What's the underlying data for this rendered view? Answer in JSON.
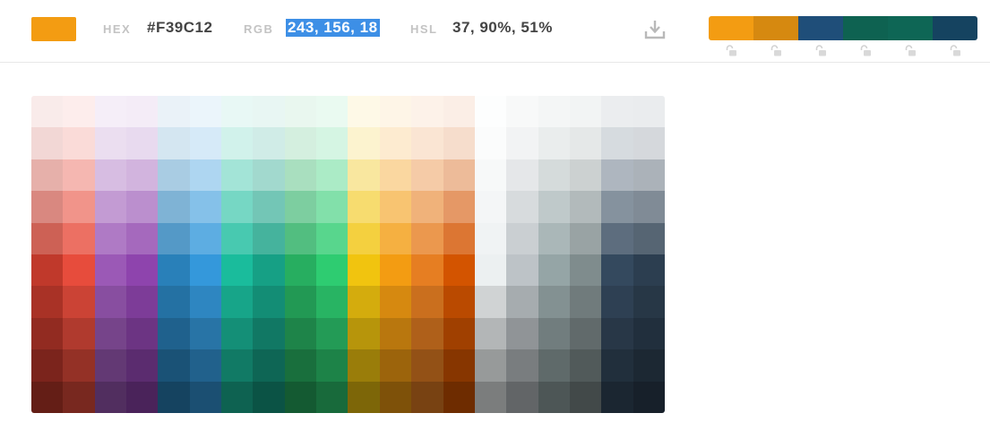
{
  "current": {
    "swatch_color": "#F39C12",
    "hex_label": "HEX",
    "hex_value": "#F39C12",
    "rgb_label": "RGB",
    "rgb_value": "243, 156, 18",
    "hsl_label": "HSL",
    "hsl_value": "37, 90%, 51%"
  },
  "toolbar": {
    "download_icon": "download-icon"
  },
  "palette": {
    "colors": [
      "#F39C12",
      "#D68910",
      "#1F4E79",
      "#0E6251",
      "#0E6655",
      "#154360"
    ],
    "lock_icon": "unlock-icon"
  },
  "grid": {
    "colors": [
      [
        "#F9EBEA",
        "#FDEDEC",
        "#F5EEF8",
        "#F4ECF7",
        "#EAF2F8",
        "#EBF5FB",
        "#E8F8F5",
        "#E8F6F3",
        "#E9F7EF",
        "#EAFAF1",
        "#FEF9E7",
        "#FEF5E7",
        "#FDF2E9",
        "#FBEEE6",
        "#FDFEFE",
        "#F8F9F9",
        "#F4F6F6",
        "#F2F4F4",
        "#EBEDEF",
        "#EAECEE"
      ],
      [
        "#F2D7D5",
        "#FADBD8",
        "#EBDEF0",
        "#E8DAEF",
        "#D4E6F1",
        "#D6EAF8",
        "#D1F2EB",
        "#D0ECE7",
        "#D4EFDF",
        "#D5F5E3",
        "#FCF3CF",
        "#FDEBD0",
        "#FAE5D3",
        "#F6DDCC",
        "#FBFCFC",
        "#F2F3F4",
        "#EAEDED",
        "#E5E8E8",
        "#D6DBDF",
        "#D5D8DC"
      ],
      [
        "#E6B0AA",
        "#F5B7B1",
        "#D7BDE2",
        "#D2B4DE",
        "#A9CCE3",
        "#AED6F1",
        "#A3E4D7",
        "#A2D9CE",
        "#A9DFBF",
        "#ABEBC6",
        "#F9E79F",
        "#FAD7A0",
        "#F5CBA7",
        "#EDBB99",
        "#F7F9F9",
        "#E5E7E9",
        "#D5DBDB",
        "#CCD1D1",
        "#AEB6BF",
        "#ABB2B9"
      ],
      [
        "#D98880",
        "#F1948A",
        "#C39BD3",
        "#BB8FCE",
        "#7FB3D5",
        "#85C1E9",
        "#76D7C4",
        "#73C6B6",
        "#7DCEA0",
        "#82E0AA",
        "#F7DC6F",
        "#F8C471",
        "#F0B27A",
        "#E59866",
        "#F4F6F7",
        "#D7DBDD",
        "#BFC9CA",
        "#B2BABB",
        "#85929E",
        "#808B96"
      ],
      [
        "#CD6155",
        "#EC7063",
        "#AF7AC5",
        "#A569BD",
        "#5499C7",
        "#5DADE2",
        "#48C9B0",
        "#45B39D",
        "#52BE80",
        "#58D68D",
        "#F4D03F",
        "#F5B041",
        "#EB984E",
        "#DC7633",
        "#F0F3F4",
        "#CACFD2",
        "#AAB7B8",
        "#99A3A4",
        "#5D6D7E",
        "#566573"
      ],
      [
        "#C0392B",
        "#E74C3C",
        "#9B59B6",
        "#8E44AD",
        "#2980B9",
        "#3498DB",
        "#1ABC9C",
        "#16A085",
        "#27AE60",
        "#2ECC71",
        "#F1C40F",
        "#F39C12",
        "#E67E22",
        "#D35400",
        "#ECF0F1",
        "#BDC3C7",
        "#95A5A6",
        "#7F8C8D",
        "#34495E",
        "#2C3E50"
      ],
      [
        "#A93226",
        "#CB4335",
        "#884EA0",
        "#7D3C98",
        "#2471A3",
        "#2E86C1",
        "#17A589",
        "#138D75",
        "#229954",
        "#28B463",
        "#D4AC0D",
        "#D68910",
        "#CA6F1E",
        "#BA4A00",
        "#D0D3D4",
        "#A6ACAF",
        "#839192",
        "#707B7C",
        "#2E4053",
        "#273746"
      ],
      [
        "#922B21",
        "#B03A2E",
        "#76448A",
        "#6C3483",
        "#1F618D",
        "#2874A6",
        "#148F77",
        "#117864",
        "#1E8449",
        "#239B56",
        "#B7950B",
        "#B9770E",
        "#AF601A",
        "#A04000",
        "#B3B6B7",
        "#909497",
        "#717D7E",
        "#616A6B",
        "#283747",
        "#212F3D"
      ],
      [
        "#7B241C",
        "#943126",
        "#633974",
        "#5B2C6F",
        "#1A5276",
        "#21618C",
        "#117A65",
        "#0E6655",
        "#196F3D",
        "#1D8348",
        "#9A7D0A",
        "#9C640C",
        "#935116",
        "#873600",
        "#979A9A",
        "#797D7F",
        "#5F6A6A",
        "#515A5A",
        "#212F3C",
        "#1C2833"
      ],
      [
        "#641E16",
        "#78281F",
        "#512E5F",
        "#4A235A",
        "#154360",
        "#1B4F72",
        "#0E6251",
        "#0B5345",
        "#145A32",
        "#186A3B",
        "#7D6608",
        "#7E5109",
        "#784212",
        "#6E2C00",
        "#7B7D7D",
        "#626567",
        "#4D5656",
        "#424949",
        "#1B2631",
        "#17202A"
      ]
    ]
  }
}
